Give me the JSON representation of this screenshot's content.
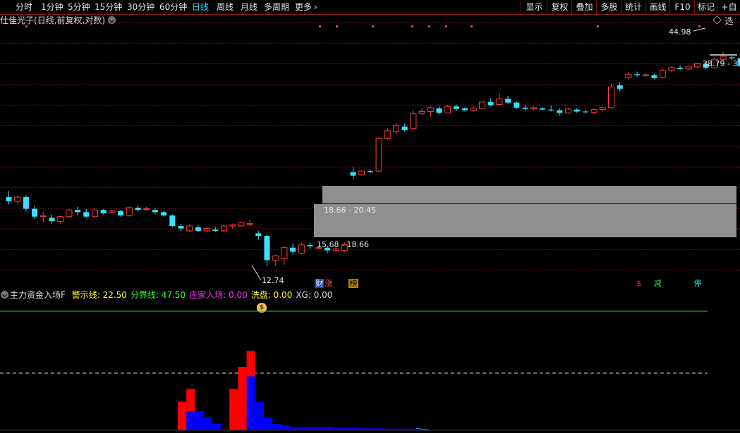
{
  "toolbar": {
    "periods": [
      "分时",
      "1分钟",
      "5分钟",
      "15分钟",
      "30分钟",
      "60分钟",
      "日线",
      "周线",
      "月线",
      "多周期",
      "更多"
    ],
    "active_period": "日线",
    "more_arrow": "›",
    "right_buttons": [
      "显示",
      "复权",
      "叠加",
      "多股",
      "统计",
      "画线",
      "F10",
      "标记",
      "+自选"
    ]
  },
  "chart_title": {
    "name": "仕佳光子",
    "info": "(日线,前复权,对数)"
  },
  "annotations": {
    "high_label": "44.98",
    "current_range": "38.79 - 3",
    "low_label": "12.74",
    "zone_upper": "18.66 - 20.45",
    "zone_lower": "15.68 - 18.66"
  },
  "signals": [
    {
      "text": "财",
      "bg": "#1f3fa8",
      "color": "#ffffff"
    },
    {
      "text": "涨",
      "bg": "#000000",
      "color": "#ff4d4d"
    },
    {
      "text": "榜",
      "bg": "#b8860b",
      "color": "#000000"
    },
    {
      "text": "$",
      "bg": "#000000",
      "color": "#ff3030"
    },
    {
      "text": "减",
      "bg": "#000000",
      "color": "#33dd33"
    },
    {
      "text": "停",
      "bg": "#000000",
      "color": "#33ddee"
    }
  ],
  "indicator": {
    "name": "主力资金入场F",
    "fields": [
      {
        "label": "警示线: 22.50",
        "color": "#ffff33"
      },
      {
        "label": "分界线: 47.50",
        "color": "#33ff33"
      },
      {
        "label": "庄家入场: 0.00",
        "color": "#ff33ff"
      },
      {
        "label": "洗盘: 0.00",
        "color": "#ffff33"
      },
      {
        "label": "XG: 0.00",
        "color": "#dddddd"
      }
    ],
    "money_icon": "money-bag-icon"
  },
  "colors": {
    "up": "#ff3b3b",
    "down": "#3ae0ff",
    "grid": "#7a1414",
    "zone": "#8f8f8f",
    "green_line": "#22cc22",
    "bar_red": "#ff0000",
    "bar_blue": "#0000ff"
  },
  "chart_data": {
    "type": "candlestick",
    "ohlc": [
      [
        18.3,
        18.9,
        17.6,
        17.9
      ],
      [
        17.9,
        18.4,
        17.6,
        18.3
      ],
      [
        18.3,
        18.5,
        17.0,
        17.2
      ],
      [
        17.2,
        17.5,
        16.3,
        16.5
      ],
      [
        16.5,
        16.9,
        16.0,
        16.6
      ],
      [
        16.4,
        16.7,
        15.9,
        16.1
      ],
      [
        16.1,
        16.6,
        15.9,
        16.5
      ],
      [
        16.5,
        17.2,
        16.4,
        17.1
      ],
      [
        17.1,
        17.4,
        16.6,
        16.9
      ],
      [
        16.9,
        17.2,
        16.4,
        16.5
      ],
      [
        16.5,
        17.3,
        16.4,
        17.1
      ],
      [
        17.1,
        17.2,
        16.7,
        16.8
      ],
      [
        16.9,
        17.1,
        16.8,
        17.0
      ],
      [
        17.0,
        17.1,
        16.5,
        16.6
      ],
      [
        16.6,
        17.4,
        16.5,
        17.3
      ],
      [
        17.3,
        17.5,
        16.9,
        17.1
      ],
      [
        17.2,
        17.4,
        17.0,
        17.2
      ],
      [
        17.1,
        17.3,
        16.7,
        16.9
      ],
      [
        16.9,
        17.0,
        16.5,
        16.6
      ],
      [
        16.6,
        16.7,
        15.6,
        15.7
      ],
      [
        15.7,
        15.9,
        15.3,
        15.5
      ],
      [
        15.3,
        15.8,
        15.2,
        15.7
      ],
      [
        15.6,
        15.8,
        15.2,
        15.3
      ],
      [
        15.3,
        15.6,
        15.2,
        15.5
      ],
      [
        15.4,
        15.6,
        15.2,
        15.3
      ],
      [
        15.3,
        15.8,
        15.2,
        15.7
      ],
      [
        15.7,
        15.9,
        15.5,
        15.8
      ],
      [
        15.7,
        16.1,
        15.6,
        16.0
      ],
      [
        15.9,
        16.2,
        15.7,
        15.9
      ],
      [
        15.1,
        15.3,
        14.6,
        14.9
      ],
      [
        14.9,
        15.0,
        12.7,
        13.1
      ],
      [
        13.1,
        13.5,
        12.7,
        13.4
      ],
      [
        13.2,
        14.1,
        12.8,
        14.0
      ],
      [
        14.0,
        14.3,
        13.5,
        13.7
      ],
      [
        13.6,
        14.4,
        13.5,
        14.2
      ],
      [
        14.2,
        14.4,
        13.9,
        14.1
      ],
      [
        14.0,
        14.1,
        13.9,
        14.0
      ],
      [
        14.0,
        14.1,
        13.6,
        13.8
      ],
      [
        13.8,
        14.0,
        13.7,
        13.9
      ],
      [
        13.8,
        14.4,
        13.7,
        14.2
      ],
      [
        20.9,
        21.5,
        20.1,
        20.5
      ],
      [
        20.6,
        21.1,
        20.5,
        21.0
      ],
      [
        21.0,
        21.2,
        20.8,
        20.9
      ],
      [
        21.0,
        25.1,
        20.9,
        25.0
      ],
      [
        25.0,
        26.4,
        24.8,
        26.0
      ],
      [
        25.9,
        27.1,
        25.5,
        26.7
      ],
      [
        26.6,
        27.0,
        25.9,
        26.1
      ],
      [
        26.3,
        29.0,
        26.2,
        28.5
      ],
      [
        28.5,
        29.3,
        28.2,
        28.8
      ],
      [
        28.8,
        29.7,
        28.0,
        29.4
      ],
      [
        29.3,
        29.6,
        28.4,
        28.6
      ],
      [
        28.6,
        29.8,
        28.5,
        29.6
      ],
      [
        29.6,
        29.9,
        28.9,
        29.2
      ],
      [
        29.3,
        29.5,
        28.8,
        29.0
      ],
      [
        29.0,
        29.7,
        28.8,
        29.3
      ],
      [
        29.3,
        30.4,
        29.2,
        30.3
      ],
      [
        30.3,
        30.9,
        29.6,
        29.8
      ],
      [
        29.9,
        31.8,
        29.8,
        30.8
      ],
      [
        30.8,
        31.3,
        30.0,
        30.2
      ],
      [
        30.2,
        30.4,
        29.2,
        29.4
      ],
      [
        29.4,
        29.8,
        29.0,
        29.2
      ],
      [
        29.2,
        29.6,
        28.9,
        29.4
      ],
      [
        29.3,
        29.5,
        29.0,
        29.1
      ],
      [
        29.1,
        29.7,
        28.8,
        29.0
      ],
      [
        29.0,
        29.3,
        28.2,
        28.6
      ],
      [
        28.6,
        29.4,
        28.4,
        29.2
      ],
      [
        29.1,
        29.3,
        28.6,
        28.8
      ],
      [
        28.8,
        29.1,
        28.5,
        28.7
      ],
      [
        28.7,
        29.3,
        28.4,
        29.1
      ],
      [
        29.1,
        29.6,
        28.8,
        29.4
      ],
      [
        29.4,
        33.4,
        29.2,
        32.8
      ],
      [
        33.1,
        33.6,
        32.1,
        32.5
      ],
      [
        34.5,
        35.6,
        34.2,
        35.1
      ],
      [
        35.1,
        35.6,
        34.6,
        34.9
      ],
      [
        34.9,
        35.3,
        34.6,
        35.0
      ],
      [
        34.9,
        35.2,
        34.2,
        34.4
      ],
      [
        34.5,
        36.3,
        34.3,
        35.8
      ],
      [
        35.8,
        36.7,
        35.5,
        36.4
      ],
      [
        36.3,
        36.8,
        35.9,
        36.1
      ],
      [
        36.1,
        36.7,
        35.9,
        36.5
      ],
      [
        36.5,
        37.3,
        36.3,
        37.1
      ],
      [
        37.1,
        37.5,
        36.0,
        36.3
      ],
      [
        36.3,
        38.3,
        36.1,
        38.0
      ],
      [
        38.0,
        39.6,
        37.6,
        38.6
      ],
      [
        38.4,
        38.7,
        37.9,
        38.2
      ],
      [
        38.2,
        38.5,
        36.2,
        36.6
      ],
      [
        36.6,
        36.9,
        36.0,
        36.4
      ],
      [
        36.4,
        36.8,
        36.1,
        36.6
      ],
      [
        36.6,
        37.1,
        36.2,
        36.9
      ],
      [
        36.8,
        38.1,
        36.1,
        37.9
      ],
      [
        38.0,
        44.98,
        37.9,
        43.6
      ]
    ],
    "y_axis": "log",
    "money_flow_hist": {
      "red": [
        9,
        13,
        0,
        0,
        0,
        0,
        13,
        20,
        25,
        9,
        0,
        0
      ],
      "blue": [
        0,
        6,
        6,
        4,
        2,
        0,
        0,
        0,
        17,
        9,
        4,
        2,
        1.5,
        1,
        1,
        1,
        1,
        1,
        0.8,
        0.8,
        0.8,
        0.6,
        0.6,
        0.6,
        0.5,
        0.5,
        0.5,
        0.5
      ]
    },
    "green_level": 47.5,
    "white_level": 22.5
  }
}
